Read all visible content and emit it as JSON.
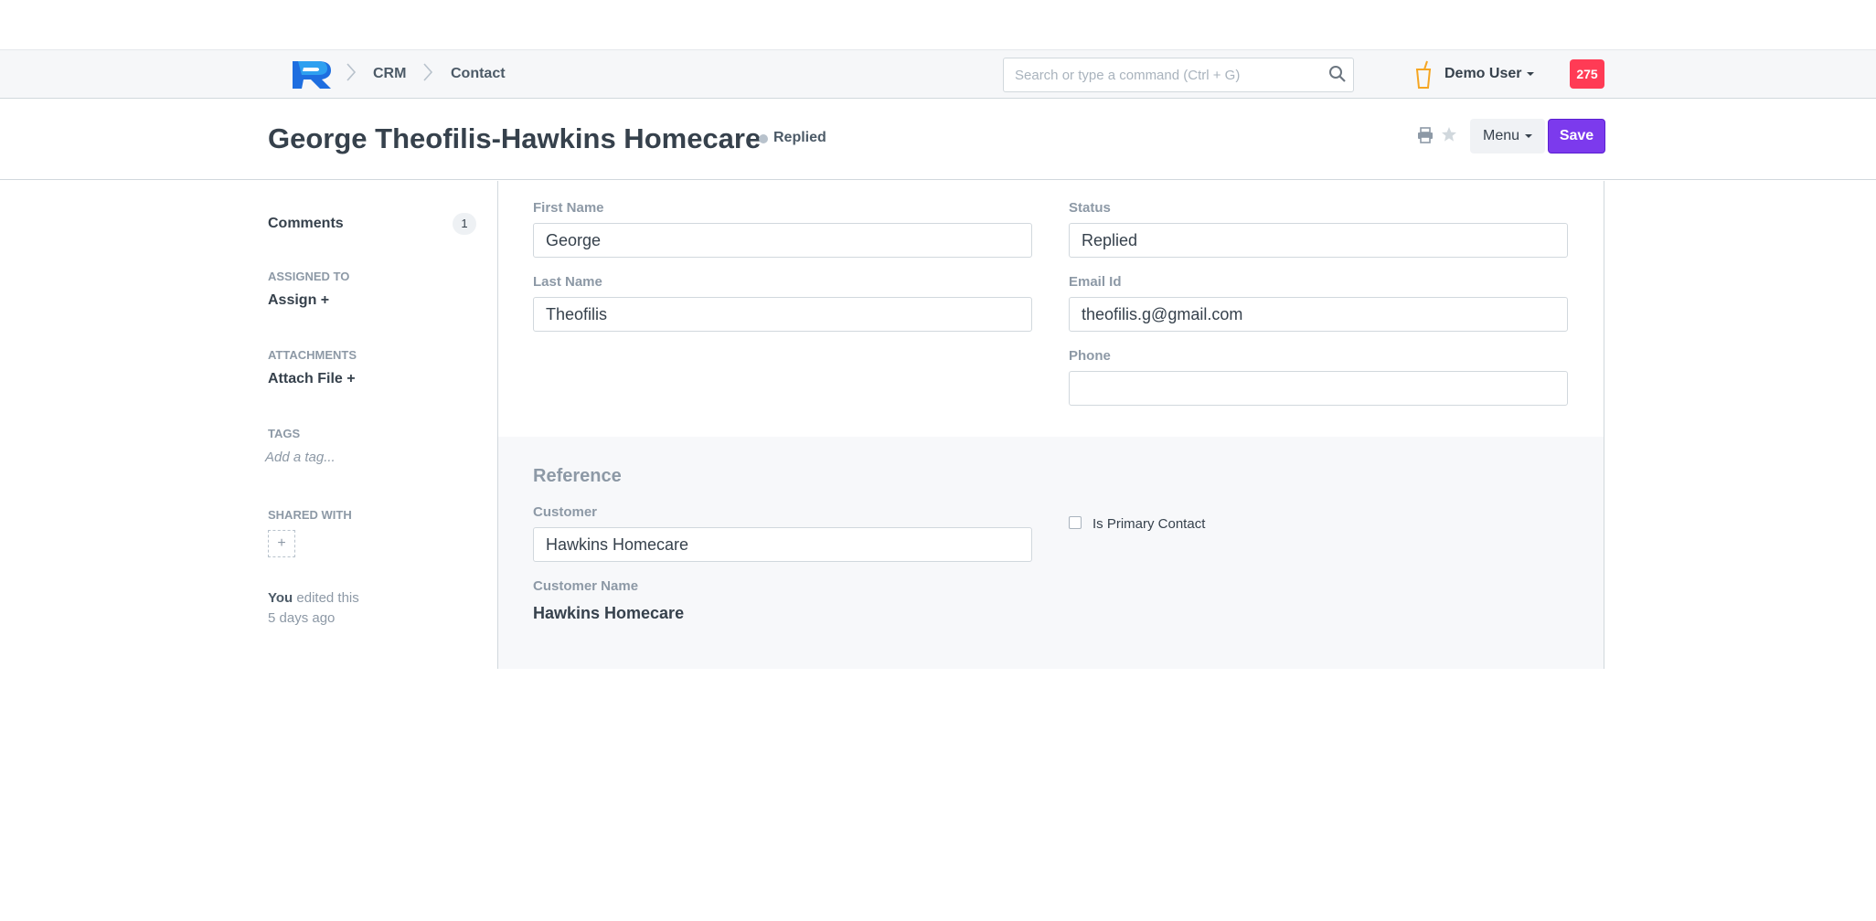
{
  "navbar": {
    "breadcrumbs": [
      "CRM",
      "Contact"
    ],
    "search_placeholder": "Search or type a command (Ctrl + G)",
    "user_name": "Demo User",
    "notification_count": "275"
  },
  "header": {
    "title": "George Theofilis-Hawkins Homecare",
    "status": "Replied",
    "menu_label": "Menu",
    "save_label": "Save"
  },
  "sidebar": {
    "comments_label": "Comments",
    "comments_count": "1",
    "assigned_to_label": "ASSIGNED TO",
    "assign_action": "Assign +",
    "attachments_label": "ATTACHMENTS",
    "attach_action": "Attach File +",
    "tags_label": "TAGS",
    "tag_placeholder": "Add a tag...",
    "shared_with_label": "SHARED WITH",
    "share_button": "+",
    "edit_user": "You",
    "edit_text": "edited this",
    "edit_time": "5 days ago"
  },
  "form": {
    "first_name_label": "First Name",
    "first_name": "George",
    "last_name_label": "Last Name",
    "last_name": "Theofilis",
    "status_label": "Status",
    "status_value": "Replied",
    "email_label": "Email Id",
    "email_value": "theofilis.g@gmail.com",
    "phone_label": "Phone",
    "phone_value": "",
    "reference_heading": "Reference",
    "customer_label": "Customer",
    "customer_value": "Hawkins Homecare",
    "customer_name_label": "Customer Name",
    "customer_name_value": "Hawkins Homecare",
    "primary_contact_label": "Is Primary Contact",
    "primary_contact_checked": false
  },
  "colors": {
    "primary": "#7c3aed",
    "badge": "#ff3b55",
    "logo_blue": "#1e6ee0"
  },
  "icons": [
    "logo-icon",
    "chevron-right-icon",
    "search-icon",
    "cup-icon",
    "caret-down-icon",
    "print-icon",
    "star-icon"
  ]
}
